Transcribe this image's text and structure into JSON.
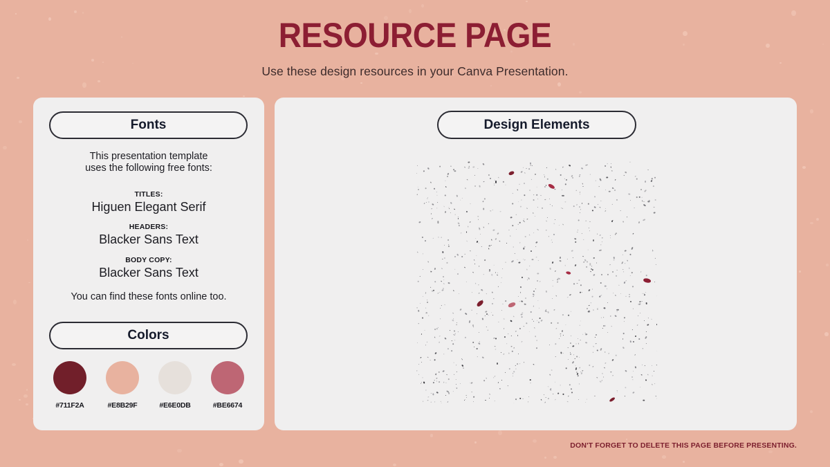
{
  "header": {
    "title": "RESOURCE PAGE",
    "subtitle": "Use these design resources in your Canva Presentation."
  },
  "fonts_panel": {
    "pill_label": "Fonts",
    "intro_line1": "This presentation template",
    "intro_line2": "uses the following free fonts:",
    "entries": [
      {
        "label": "TITLES:",
        "value": "Higuen Elegant Serif"
      },
      {
        "label": "HEADERS:",
        "value": "Blacker Sans Text"
      },
      {
        "label": "BODY COPY:",
        "value": "Blacker Sans Text"
      }
    ],
    "outro": "You can find these fonts online too."
  },
  "colors_panel": {
    "pill_label": "Colors",
    "swatches": [
      {
        "hex": "#711F2A",
        "label": "#711F2A"
      },
      {
        "hex": "#E8B29F",
        "label": "#E8B29F"
      },
      {
        "hex": "#E6E0DB",
        "label": "#E6E0DB"
      },
      {
        "hex": "#BE6674",
        "label": "#BE6674"
      }
    ]
  },
  "elements_panel": {
    "pill_label": "Design Elements",
    "graphic_name": "confetti-speckle-texture"
  },
  "footer": {
    "note": "DON'T FORGET TO DELETE THIS PAGE BEFORE PRESENTING."
  },
  "theme": {
    "background": "#E8B29F",
    "card_background": "#F0EFEF",
    "title_color": "#8C1E33",
    "text_color": "#1C1C22",
    "footer_color": "#7C1F2E",
    "pill_border": "#2B2B33"
  }
}
